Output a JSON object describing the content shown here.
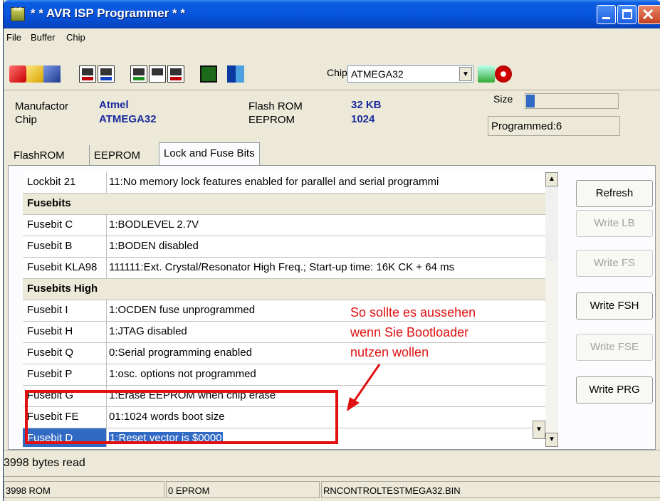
{
  "window": {
    "title": "* * AVR ISP Programmer * *"
  },
  "menu": [
    "File",
    "Buffer",
    "Chip"
  ],
  "toolbar": {
    "icons": [
      "eraser-icon",
      "open-folder-icon",
      "save-disk-icon",
      "chip-read-red-icon",
      "chip-read-blue-icon",
      "chip-write-icon",
      "chip-write-red-icon",
      "chip-verify-icon",
      "dark-chip-icon",
      "book-icon",
      "program-icon",
      "stop-icon"
    ],
    "chip_label": "Chip",
    "chip_value": "ATMEGA32"
  },
  "info": {
    "manufactor_label": "Manufactor",
    "manufactor_value": "Atmel",
    "chip_label": "Chip",
    "chip_value": "ATMEGA32",
    "flash_label": "Flash ROM",
    "flash_value": "32 KB",
    "eeprom_label": "EEPROM",
    "eeprom_value": "1024",
    "size_label": "Size",
    "size_fill": 0.09,
    "programmed": "Programmed:6"
  },
  "tabs": [
    "FlashROM",
    "EEPROM",
    "Lock and Fuse Bits"
  ],
  "rows": [
    {
      "name": "Lockbit 21",
      "value": "11:No memory lock features enabled for parallel and serial programmi"
    },
    {
      "header": "Fusebits"
    },
    {
      "name": "Fusebit C",
      "value": "1:BODLEVEL 2.7V"
    },
    {
      "name": "Fusebit B",
      "value": "1:BODEN disabled"
    },
    {
      "name": "Fusebit KLA98",
      "value": "111111:Ext. Crystal/Resonator High Freq.; Start-up time: 16K CK + 64 ms"
    },
    {
      "header": "Fusebits High"
    },
    {
      "name": "Fusebit I",
      "value": "1:OCDEN fuse unprogrammed"
    },
    {
      "name": "Fusebit H",
      "value": "1:JTAG disabled"
    },
    {
      "name": "Fusebit Q",
      "value": "0:Serial programming enabled"
    },
    {
      "name": "Fusebit P",
      "value": "1:osc. options not programmed"
    },
    {
      "name": "Fusebit G",
      "value": "1:Erase EEPROM when chip erase"
    },
    {
      "name": "Fusebit FE",
      "value": "01:1024 words boot size"
    },
    {
      "name": "Fusebit D",
      "value": "1:Reset vector is $0000",
      "selected": true
    }
  ],
  "buttons": {
    "refresh": "Refresh",
    "write_lb": "Write LB",
    "write_fs": "Write FS",
    "write_fsh": "Write FSH",
    "write_fse": "Write FSE",
    "write_prg": "Write PRG"
  },
  "annotation": {
    "line1": "So sollte es aussehen",
    "line2": "wenn Sie Bootloader",
    "line3": "nutzen wollen",
    "color": "#e01010"
  },
  "status": {
    "message": "3998 bytes read",
    "rom": "3998 ROM",
    "eprom": "0 EPROM",
    "file": "RNCONTROLTESTMEGA32.BIN"
  }
}
